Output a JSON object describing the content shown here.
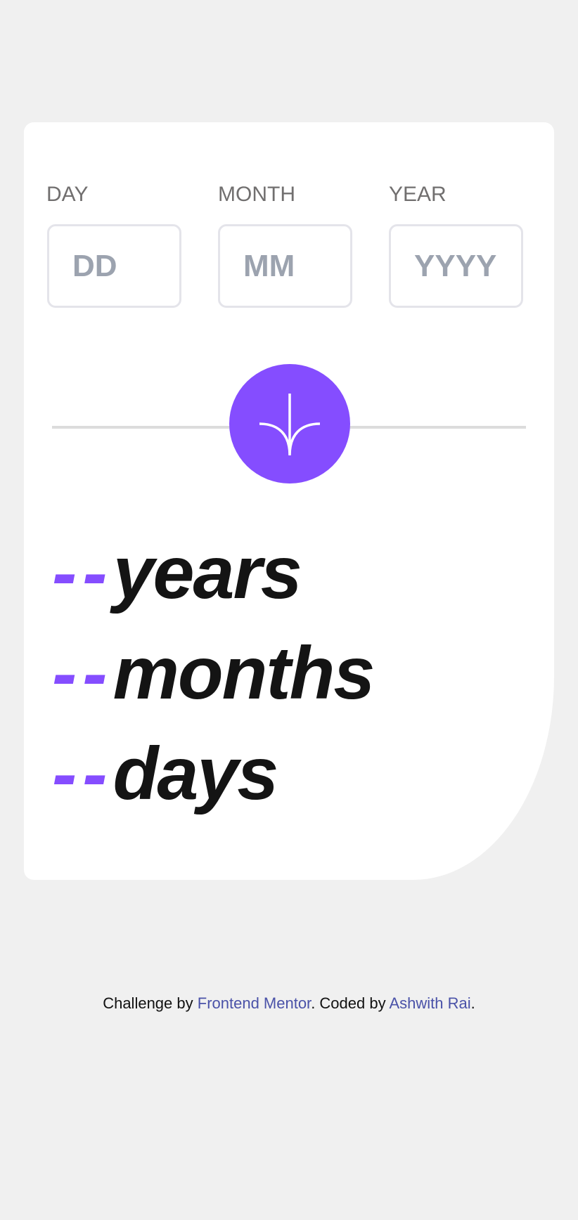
{
  "form": {
    "day": {
      "label": "DAY",
      "placeholder": "DD",
      "value": ""
    },
    "month": {
      "label": "MONTH",
      "placeholder": "MM",
      "value": ""
    },
    "year": {
      "label": "YEAR",
      "placeholder": "YYYY",
      "value": ""
    },
    "submit_icon": "arrow-down-icon"
  },
  "results": [
    {
      "value": "--",
      "unit": "years"
    },
    {
      "value": "--",
      "unit": "months"
    },
    {
      "value": "--",
      "unit": "days"
    }
  ],
  "footer": {
    "prefix": "Challenge by ",
    "link1": "Frontend Mentor",
    "middle": ". Coded by ",
    "link2": "Ashwith Rai",
    "suffix": "."
  },
  "colors": {
    "accent": "#854dff",
    "text": "#141414",
    "label": "#716f6f",
    "link": "#4a52a8"
  }
}
